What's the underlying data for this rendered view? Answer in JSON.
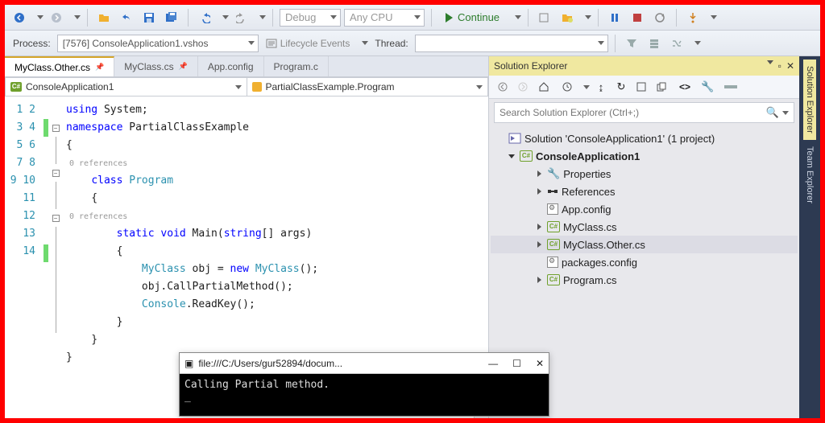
{
  "toolbar": {
    "config_combo": "Debug",
    "platform_combo": "Any CPU",
    "continue_label": "Continue"
  },
  "process_bar": {
    "process_label": "Process:",
    "process_value": "[7576] ConsoleApplication1.vshos",
    "lifecycle_label": "Lifecycle Events",
    "thread_label": "Thread:"
  },
  "tabs": [
    {
      "label": "MyClass.Other.cs",
      "pinned": true,
      "active": true
    },
    {
      "label": "MyClass.cs",
      "pinned": true,
      "active": false
    },
    {
      "label": "App.config",
      "pinned": false,
      "active": false
    },
    {
      "label": "Program.c",
      "pinned": false,
      "active": false
    }
  ],
  "nav": {
    "left": "ConsoleApplication1",
    "right": "PartialClassExample.Program"
  },
  "code": {
    "lines": [
      {
        "n": 1,
        "t": "using System;"
      },
      {
        "n": 2,
        "t": "namespace PartialClassExample"
      },
      {
        "n": 3,
        "t": "{"
      },
      {
        "n": 4,
        "t": "    class Program"
      },
      {
        "n": 5,
        "t": "    {"
      },
      {
        "n": 6,
        "t": "        static void Main(string[] args)"
      },
      {
        "n": 7,
        "t": "        {"
      },
      {
        "n": 8,
        "t": "            MyClass obj = new MyClass();"
      },
      {
        "n": 9,
        "t": "            obj.CallPartialMethod();"
      },
      {
        "n": 10,
        "t": "            Console.ReadKey();"
      },
      {
        "n": 11,
        "t": "        }"
      },
      {
        "n": 12,
        "t": "    }"
      },
      {
        "n": 13,
        "t": "}"
      },
      {
        "n": 14,
        "t": ""
      }
    ],
    "ref0": "0 references",
    "ref1": "0 references"
  },
  "solution": {
    "title": "Solution Explorer",
    "search_placeholder": "Search Solution Explorer (Ctrl+;)",
    "root": "Solution 'ConsoleApplication1' (1 project)",
    "project": "ConsoleApplication1",
    "items": [
      {
        "label": "Properties",
        "icon": "wrench",
        "tw": "r",
        "depth": 2
      },
      {
        "label": "References",
        "icon": "ref",
        "tw": "r",
        "depth": 2
      },
      {
        "label": "App.config",
        "icon": "cfg",
        "tw": "",
        "depth": 2
      },
      {
        "label": "MyClass.cs",
        "icon": "cs",
        "tw": "r",
        "depth": 2
      },
      {
        "label": "MyClass.Other.cs",
        "icon": "cs",
        "tw": "r",
        "depth": 2,
        "sel": true
      },
      {
        "label": "packages.config",
        "icon": "cfg",
        "tw": "",
        "depth": 2
      },
      {
        "label": "Program.cs",
        "icon": "cs",
        "tw": "r",
        "depth": 2
      }
    ]
  },
  "side_tabs": [
    {
      "label": "Solution Explorer",
      "active": true
    },
    {
      "label": "Team Explorer",
      "active": false
    }
  ],
  "console": {
    "title": "file:///C:/Users/gur52894/docum...",
    "output": "Calling Partial method.\n_"
  }
}
